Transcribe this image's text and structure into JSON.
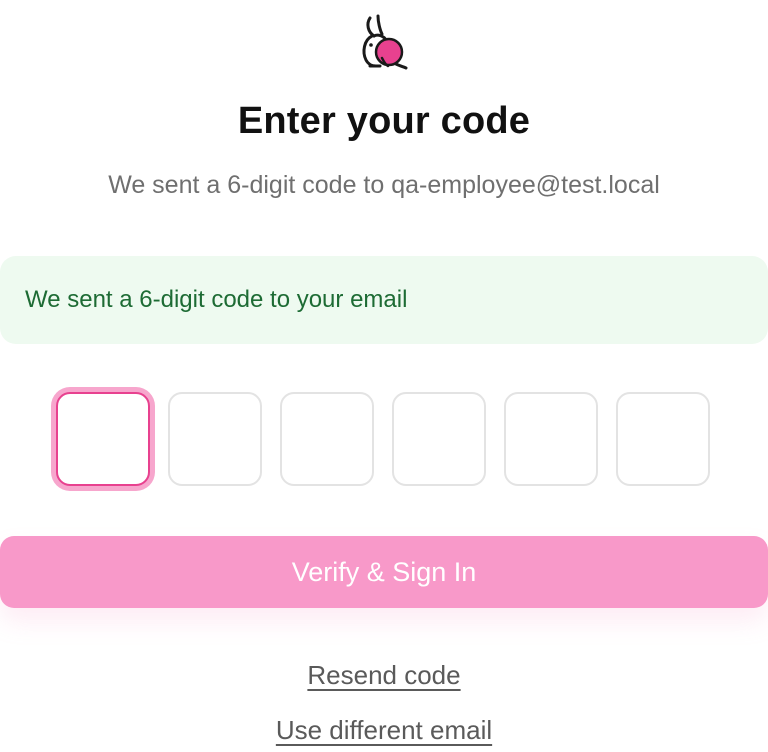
{
  "brand": {
    "logo_icon": "rabbit-logo-icon",
    "accent_color": "#e8418f"
  },
  "header": {
    "title": "Enter your code",
    "subtitle": "We sent a 6-digit code to qa-employee@test.local"
  },
  "alert": {
    "message": "We sent a 6-digit code to your email",
    "status": "success",
    "color": "#1d6b34"
  },
  "otp": {
    "length": 6,
    "digits": [
      "",
      "",
      "",
      "",
      "",
      ""
    ],
    "focused_index": 0
  },
  "actions": {
    "verify_label": "Verify & Sign In",
    "resend_label": "Resend code",
    "change_email_label": "Use different email"
  }
}
